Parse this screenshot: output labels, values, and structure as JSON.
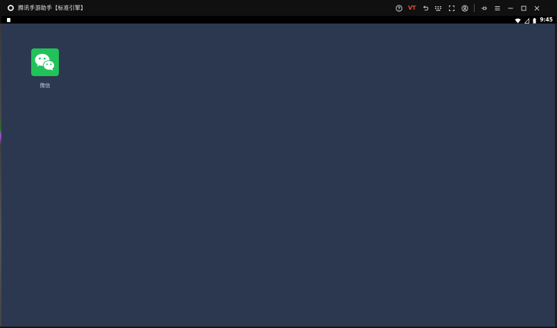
{
  "window": {
    "title": "腾讯手游助手【标准引擎】"
  },
  "titlebar": {
    "controls": [
      {
        "name": "help-icon"
      },
      {
        "name": "vt-icon",
        "label": "VT"
      },
      {
        "name": "back-icon"
      },
      {
        "name": "keyboard-icon"
      },
      {
        "name": "fullscreen-icon"
      },
      {
        "name": "account-icon"
      },
      {
        "name": "pin-icon"
      },
      {
        "name": "menu-icon"
      },
      {
        "name": "minimize-icon"
      },
      {
        "name": "maximize-icon"
      },
      {
        "name": "close-icon"
      }
    ],
    "vt_label": "VT",
    "vt_color": "#e24a3b"
  },
  "statusbar": {
    "time": "9:45",
    "icons": [
      "notification-icon",
      "wifi-icon",
      "signal-icon",
      "battery-icon"
    ]
  },
  "desktop": {
    "background": "#2c3850",
    "apps": [
      {
        "label": "微信",
        "icon": "wechat-icon",
        "color": "#21c25a"
      }
    ]
  }
}
